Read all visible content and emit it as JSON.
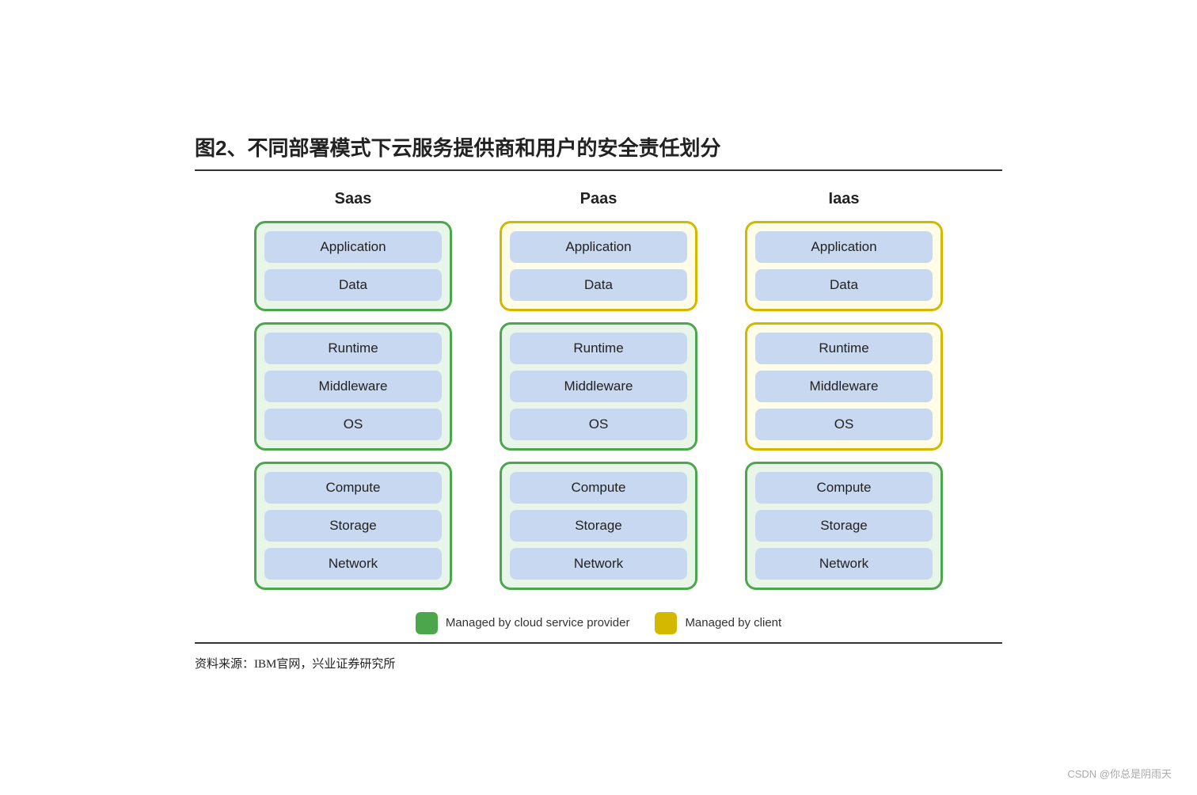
{
  "title": "图2、不同部署模式下云服务提供商和用户的安全责任划分",
  "columns": [
    {
      "header": "Saas",
      "groups": [
        {
          "type": "green",
          "items": [
            "Application",
            "Data"
          ]
        },
        {
          "type": "green",
          "items": [
            "Runtime",
            "Middleware",
            "OS"
          ]
        },
        {
          "type": "green",
          "items": [
            "Compute",
            "Storage",
            "Network"
          ]
        }
      ]
    },
    {
      "header": "Paas",
      "groups": [
        {
          "type": "yellow",
          "items": [
            "Application",
            "Data"
          ]
        },
        {
          "type": "green",
          "items": [
            "Runtime",
            "Middleware",
            "OS"
          ]
        },
        {
          "type": "green",
          "items": [
            "Compute",
            "Storage",
            "Network"
          ]
        }
      ]
    },
    {
      "header": "Iaas",
      "groups": [
        {
          "type": "yellow",
          "items": [
            "Application",
            "Data"
          ]
        },
        {
          "type": "yellow",
          "items": [
            "Runtime",
            "Middleware",
            "OS"
          ]
        },
        {
          "type": "green",
          "items": [
            "Compute",
            "Storage",
            "Network"
          ]
        }
      ]
    }
  ],
  "legend": [
    {
      "color": "green",
      "label": "Managed by cloud service provider"
    },
    {
      "color": "yellow",
      "label": "Managed by client"
    }
  ],
  "source": "资料来源：IBM官网，兴业证券研究所",
  "watermark": "CSDN @你总是阴雨天"
}
